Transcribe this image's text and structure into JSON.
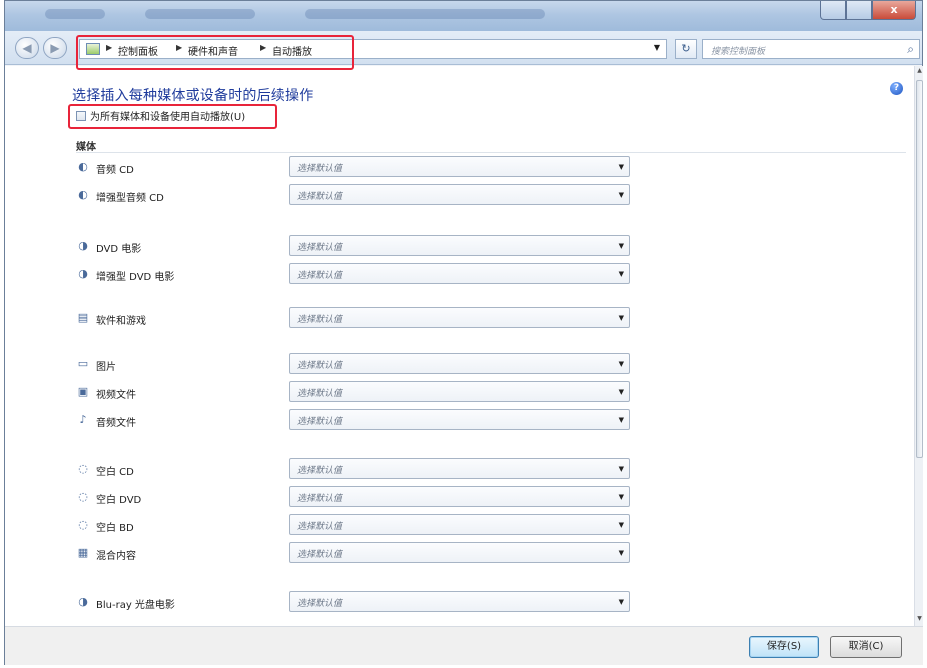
{
  "window": {
    "close_symbol": "x"
  },
  "navigation": {
    "back_symbol": "◀",
    "forward_symbol": "▶",
    "breadcrumb": [
      "控制面板",
      "硬件和声音",
      "自动播放"
    ],
    "search_placeholder": "搜索控制面板",
    "refresh_symbol": "↻",
    "search_icon": "⌕"
  },
  "content": {
    "heading": "选择插入每种媒体或设备时的后续操作",
    "help_symbol": "?",
    "autoplay_checkbox_label": "为所有媒体和设备使用自动播放(U)",
    "autoplay_checked": false,
    "section_label": "媒体",
    "default_select_value": "选择默认值",
    "media_items": [
      {
        "label": "音频 CD",
        "icon": "cd-audio-icon",
        "glyph": "◐",
        "value": "选择默认值"
      },
      {
        "label": "增强型音频 CD",
        "icon": "cd-enhanced-icon",
        "glyph": "◐",
        "value": "选择默认值"
      },
      {
        "label": "DVD 电影",
        "icon": "dvd-movie-icon",
        "glyph": "◑",
        "value": "选择默认值"
      },
      {
        "label": "增强型 DVD 电影",
        "icon": "dvd-enhanced-icon",
        "glyph": "◑",
        "value": "选择默认值"
      },
      {
        "label": "软件和游戏",
        "icon": "software-games-icon",
        "glyph": "▤",
        "value": "选择默认值"
      },
      {
        "label": "图片",
        "icon": "pictures-icon",
        "glyph": "▭",
        "value": "选择默认值"
      },
      {
        "label": "视频文件",
        "icon": "video-files-icon",
        "glyph": "▣",
        "value": "选择默认值"
      },
      {
        "label": "音频文件",
        "icon": "audio-files-icon",
        "glyph": "♪",
        "value": "选择默认值"
      },
      {
        "label": "空白 CD",
        "icon": "blank-cd-icon",
        "glyph": "◌",
        "value": "选择默认值"
      },
      {
        "label": "空白 DVD",
        "icon": "blank-dvd-icon",
        "glyph": "◌",
        "value": "选择默认值"
      },
      {
        "label": "空白 BD",
        "icon": "blank-bd-icon",
        "glyph": "◌",
        "value": "选择默认值"
      },
      {
        "label": "混合内容",
        "icon": "mixed-content-icon",
        "glyph": "▦",
        "value": "选择默认值"
      },
      {
        "label": "Blu-ray 光盘电影",
        "icon": "bluray-movie-icon",
        "glyph": "◑",
        "value": "选择默认值"
      }
    ]
  },
  "footer": {
    "save_label": "保存(S)",
    "cancel_label": "取消(C)"
  },
  "colors": {
    "heading": "#1f3b9c",
    "highlight_box": "#e8243a"
  }
}
